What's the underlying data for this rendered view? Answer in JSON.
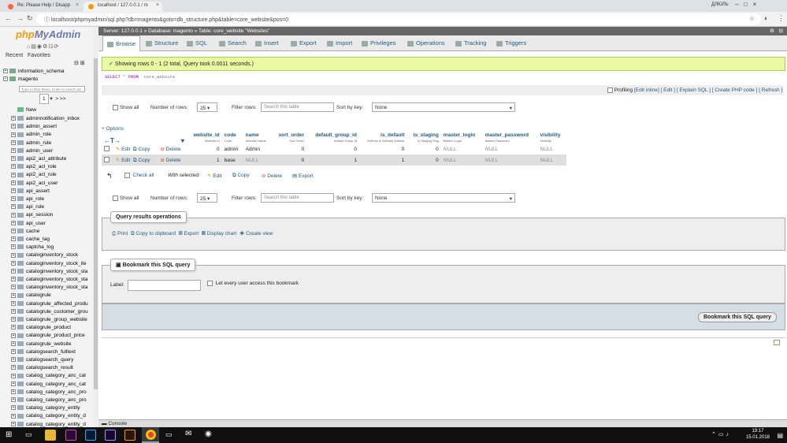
{
  "browser": {
    "tabs": [
      {
        "title": "Re: Please Help ! Disapp",
        "favicon_color": "#ff6633"
      },
      {
        "title": "localhost / 127.0.0.1 / m",
        "favicon_color": "#f89c0e"
      }
    ],
    "url": "localhost/phpmyadmin/sql.php?db=magento&goto=db_structure.php&table=core_website&pos=0",
    "profile": "ДЛЮЛЬ"
  },
  "sidebar": {
    "logo_php": "php",
    "logo_my": "MyAdmin",
    "recent": "Recent",
    "favorites": "Favorites",
    "databases": [
      "information_schema",
      "magento"
    ],
    "filter_placeholder": "Type to filter these, Enter to search all",
    "page_select": "1",
    "next": "> >>",
    "new_label": "New",
    "tables": [
      "adminnotification_inbox",
      "admin_assert",
      "admin_role",
      "admin_rule",
      "admin_user",
      "api2_acl_attribute",
      "api2_acl_role",
      "api2_acl_rule",
      "api2_acl_user",
      "api_assert",
      "api_role",
      "api_rule",
      "api_session",
      "api_user",
      "cache",
      "cache_tag",
      "captcha_log",
      "cataloginventory_stock",
      "cataloginventory_stock_ite",
      "cataloginventory_stock_sta",
      "cataloginventory_stock_sta",
      "cataloginventory_stock_sta",
      "catalogrule",
      "catalogrule_affected_produ",
      "catalogrule_customer_grou",
      "catalogrule_group_website",
      "catalogrule_product",
      "catalogrule_product_price",
      "catalogrule_website",
      "catalogsearch_fulltext",
      "catalogsearch_query",
      "catalogsearch_result",
      "catalog_category_anc_cat",
      "catalog_category_anc_cat",
      "catalog_category_anc_pro",
      "catalog_category_anc_pro",
      "catalog_category_entity",
      "catalog_category_entity_d",
      "catalog_category_entity_d"
    ]
  },
  "breadcrumb": {
    "server": "Server: 127.0.0.1",
    "database": "Database: magento",
    "table": "Table: core_website \"Websites\""
  },
  "tabs": [
    "Browse",
    "Structure",
    "SQL",
    "Search",
    "Insert",
    "Export",
    "Import",
    "Privileges",
    "Operations",
    "Tracking",
    "Triggers"
  ],
  "success": "Showing rows 0 - 1 (2 total, Query took 0.0011 seconds.)",
  "sql": {
    "keyword1": "SELECT",
    "middle": "* ",
    "keyword2": "FROM",
    "table": "`core_website`"
  },
  "profiling": {
    "label": "Profiling",
    "links": "[Edit inline] [ Edit ] [ Explain SQL ] [ Create PHP code ] [ Refresh ]"
  },
  "nav": {
    "show_all": "Show all",
    "rows_label": "Number of rows:",
    "rows_value": "25",
    "filter_label": "Filter rows:",
    "filter_placeholder": "Search this table",
    "sort_label": "Sort by key:",
    "sort_value": "None"
  },
  "options_link": "+ Options",
  "columns": [
    {
      "name": "website_id",
      "comment": "Website Id"
    },
    {
      "name": "code",
      "comment": "Code"
    },
    {
      "name": "name",
      "comment": "Website Name"
    },
    {
      "name": "sort_order",
      "comment": "Sort Order"
    },
    {
      "name": "default_group_id",
      "comment": "Default Group Id"
    },
    {
      "name": "is_default",
      "comment": "Defines Is Website Default"
    },
    {
      "name": "is_staging",
      "comment": "Is Staging Flag"
    },
    {
      "name": "master_login",
      "comment": "Master Login"
    },
    {
      "name": "master_password",
      "comment": "Master Password"
    },
    {
      "name": "visibility",
      "comment": "Visibility"
    }
  ],
  "row_actions": {
    "edit": "Edit",
    "copy": "Copy",
    "delete": "Delete"
  },
  "rows": [
    [
      "0",
      "admin",
      "Admin",
      "0",
      "0",
      "0",
      "0",
      "NULL",
      "NULL",
      "NULL"
    ],
    [
      "1",
      "base",
      "NULL",
      "0",
      "1",
      "1",
      "0",
      "NULL",
      "NULL",
      "NULL"
    ]
  ],
  "bulk": {
    "check_all": "Check all",
    "with_selected": "With selected:",
    "edit": "Edit",
    "copy": "Copy",
    "delete": "Delete",
    "export": "Export"
  },
  "query_ops": {
    "legend": "Query results operations",
    "print": "Print",
    "copy_clipboard": "Copy to clipboard",
    "export": "Export",
    "display_chart": "Display chart",
    "create_view": "Create view"
  },
  "bookmark": {
    "legend": "Bookmark this SQL query",
    "label": "Label:",
    "every_user": "Let every user access this bookmark",
    "button": "Bookmark this SQL query"
  },
  "console": "Console",
  "clock": {
    "time": "19:17",
    "date": "15.01.2018"
  },
  "colors": {
    "accent_link": "#235a81",
    "success_bg": "#ebf8a4",
    "topbar": "#666666"
  }
}
